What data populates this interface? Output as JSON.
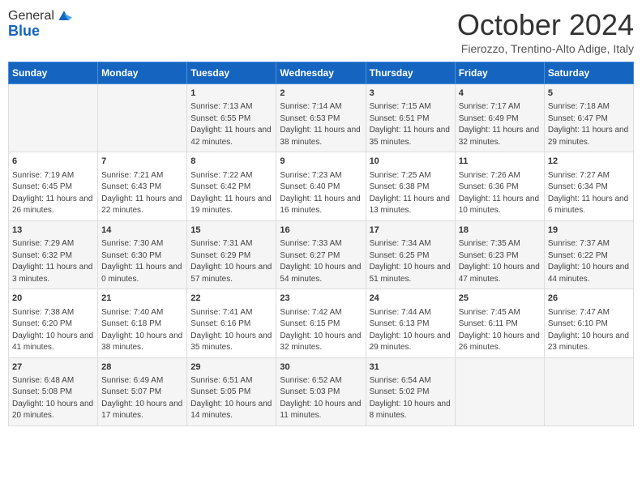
{
  "logo": {
    "general": "General",
    "blue": "Blue"
  },
  "header": {
    "month": "October 2024",
    "location": "Fierozzo, Trentino-Alto Adige, Italy"
  },
  "days_of_week": [
    "Sunday",
    "Monday",
    "Tuesday",
    "Wednesday",
    "Thursday",
    "Friday",
    "Saturday"
  ],
  "weeks": [
    [
      {
        "day": "",
        "info": ""
      },
      {
        "day": "",
        "info": ""
      },
      {
        "day": "1",
        "info": "Sunrise: 7:13 AM\nSunset: 6:55 PM\nDaylight: 11 hours and 42 minutes."
      },
      {
        "day": "2",
        "info": "Sunrise: 7:14 AM\nSunset: 6:53 PM\nDaylight: 11 hours and 38 minutes."
      },
      {
        "day": "3",
        "info": "Sunrise: 7:15 AM\nSunset: 6:51 PM\nDaylight: 11 hours and 35 minutes."
      },
      {
        "day": "4",
        "info": "Sunrise: 7:17 AM\nSunset: 6:49 PM\nDaylight: 11 hours and 32 minutes."
      },
      {
        "day": "5",
        "info": "Sunrise: 7:18 AM\nSunset: 6:47 PM\nDaylight: 11 hours and 29 minutes."
      }
    ],
    [
      {
        "day": "6",
        "info": "Sunrise: 7:19 AM\nSunset: 6:45 PM\nDaylight: 11 hours and 26 minutes."
      },
      {
        "day": "7",
        "info": "Sunrise: 7:21 AM\nSunset: 6:43 PM\nDaylight: 11 hours and 22 minutes."
      },
      {
        "day": "8",
        "info": "Sunrise: 7:22 AM\nSunset: 6:42 PM\nDaylight: 11 hours and 19 minutes."
      },
      {
        "day": "9",
        "info": "Sunrise: 7:23 AM\nSunset: 6:40 PM\nDaylight: 11 hours and 16 minutes."
      },
      {
        "day": "10",
        "info": "Sunrise: 7:25 AM\nSunset: 6:38 PM\nDaylight: 11 hours and 13 minutes."
      },
      {
        "day": "11",
        "info": "Sunrise: 7:26 AM\nSunset: 6:36 PM\nDaylight: 11 hours and 10 minutes."
      },
      {
        "day": "12",
        "info": "Sunrise: 7:27 AM\nSunset: 6:34 PM\nDaylight: 11 hours and 6 minutes."
      }
    ],
    [
      {
        "day": "13",
        "info": "Sunrise: 7:29 AM\nSunset: 6:32 PM\nDaylight: 11 hours and 3 minutes."
      },
      {
        "day": "14",
        "info": "Sunrise: 7:30 AM\nSunset: 6:30 PM\nDaylight: 11 hours and 0 minutes."
      },
      {
        "day": "15",
        "info": "Sunrise: 7:31 AM\nSunset: 6:29 PM\nDaylight: 10 hours and 57 minutes."
      },
      {
        "day": "16",
        "info": "Sunrise: 7:33 AM\nSunset: 6:27 PM\nDaylight: 10 hours and 54 minutes."
      },
      {
        "day": "17",
        "info": "Sunrise: 7:34 AM\nSunset: 6:25 PM\nDaylight: 10 hours and 51 minutes."
      },
      {
        "day": "18",
        "info": "Sunrise: 7:35 AM\nSunset: 6:23 PM\nDaylight: 10 hours and 47 minutes."
      },
      {
        "day": "19",
        "info": "Sunrise: 7:37 AM\nSunset: 6:22 PM\nDaylight: 10 hours and 44 minutes."
      }
    ],
    [
      {
        "day": "20",
        "info": "Sunrise: 7:38 AM\nSunset: 6:20 PM\nDaylight: 10 hours and 41 minutes."
      },
      {
        "day": "21",
        "info": "Sunrise: 7:40 AM\nSunset: 6:18 PM\nDaylight: 10 hours and 38 minutes."
      },
      {
        "day": "22",
        "info": "Sunrise: 7:41 AM\nSunset: 6:16 PM\nDaylight: 10 hours and 35 minutes."
      },
      {
        "day": "23",
        "info": "Sunrise: 7:42 AM\nSunset: 6:15 PM\nDaylight: 10 hours and 32 minutes."
      },
      {
        "day": "24",
        "info": "Sunrise: 7:44 AM\nSunset: 6:13 PM\nDaylight: 10 hours and 29 minutes."
      },
      {
        "day": "25",
        "info": "Sunrise: 7:45 AM\nSunset: 6:11 PM\nDaylight: 10 hours and 26 minutes."
      },
      {
        "day": "26",
        "info": "Sunrise: 7:47 AM\nSunset: 6:10 PM\nDaylight: 10 hours and 23 minutes."
      }
    ],
    [
      {
        "day": "27",
        "info": "Sunrise: 6:48 AM\nSunset: 5:08 PM\nDaylight: 10 hours and 20 minutes."
      },
      {
        "day": "28",
        "info": "Sunrise: 6:49 AM\nSunset: 5:07 PM\nDaylight: 10 hours and 17 minutes."
      },
      {
        "day": "29",
        "info": "Sunrise: 6:51 AM\nSunset: 5:05 PM\nDaylight: 10 hours and 14 minutes."
      },
      {
        "day": "30",
        "info": "Sunrise: 6:52 AM\nSunset: 5:03 PM\nDaylight: 10 hours and 11 minutes."
      },
      {
        "day": "31",
        "info": "Sunrise: 6:54 AM\nSunset: 5:02 PM\nDaylight: 10 hours and 8 minutes."
      },
      {
        "day": "",
        "info": ""
      },
      {
        "day": "",
        "info": ""
      }
    ]
  ]
}
